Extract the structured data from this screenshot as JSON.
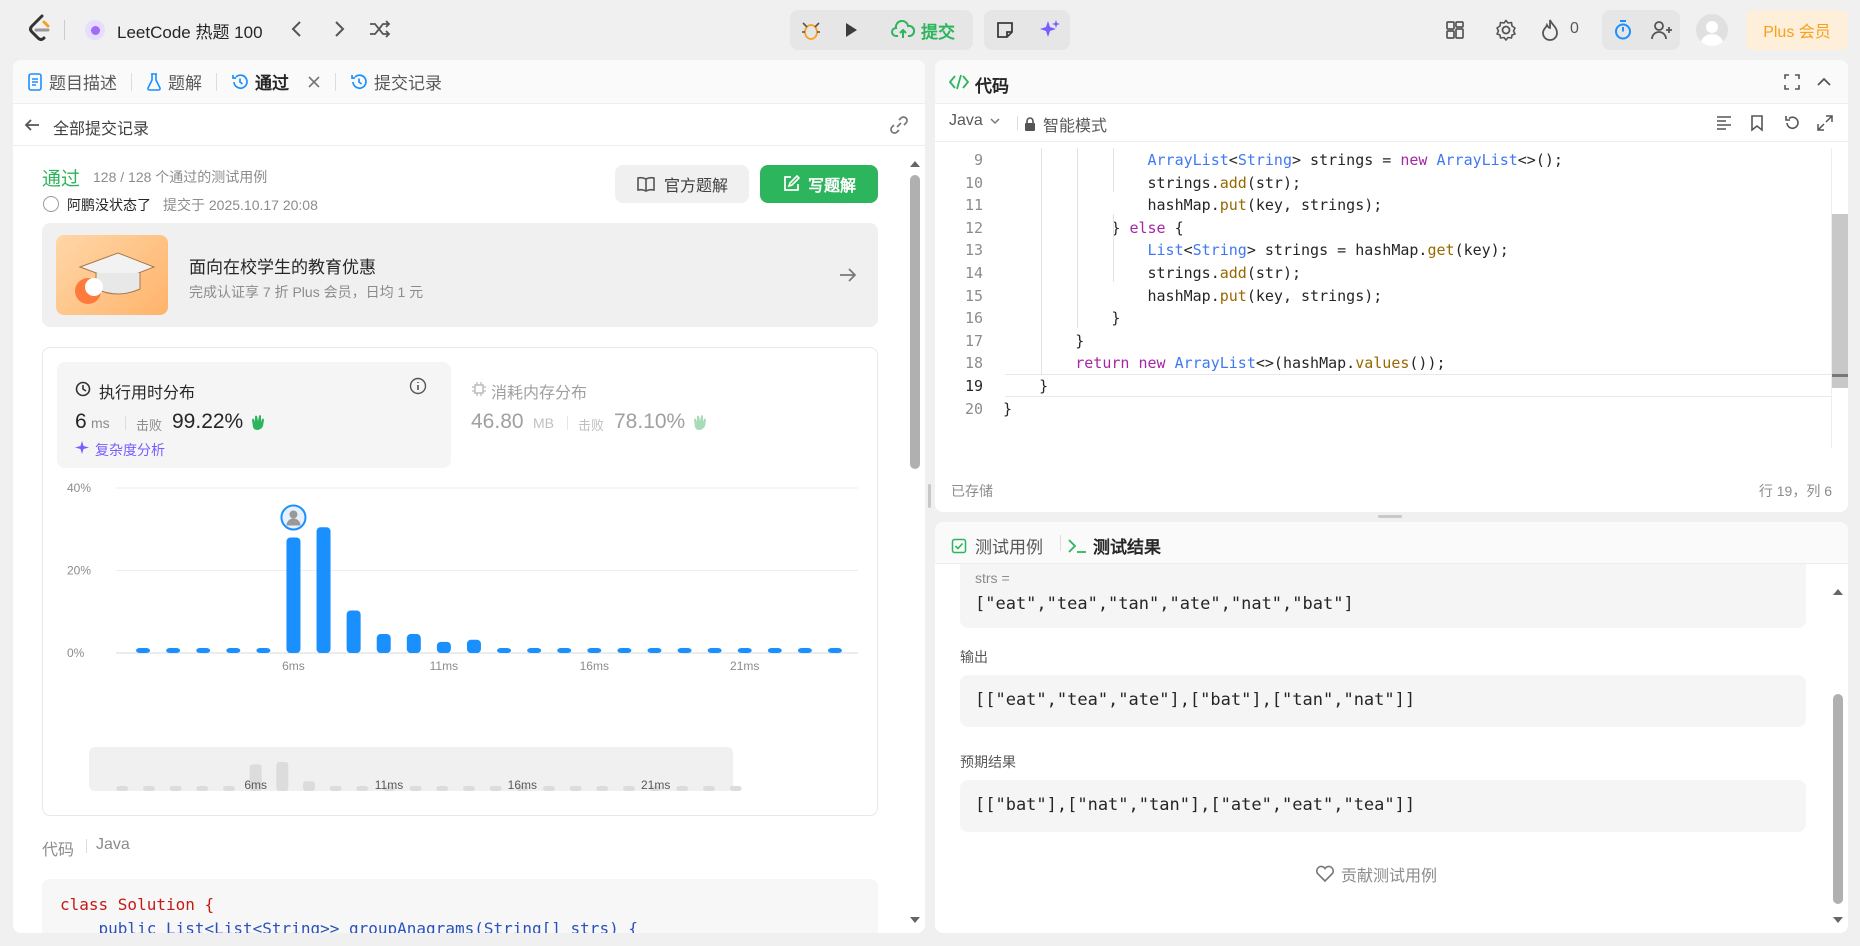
{
  "topbar": {
    "title": "LeetCode 热题 100",
    "submit": "提交",
    "fire_count": "0",
    "plus": "Plus 会员"
  },
  "left": {
    "tabs": [
      {
        "label": "题目描述"
      },
      {
        "label": "题解"
      },
      {
        "label": "通过"
      },
      {
        "label": "提交记录"
      }
    ],
    "back": "全部提交记录",
    "status": "通过",
    "cases": "128 / 128 个通过的测试用例",
    "user": "阿鹏没状态了",
    "submitted": "提交于 2025.10.17 20:08",
    "official": "官方题解",
    "write": "写题解",
    "promo_title": "面向在校学生的教育优惠",
    "promo_sub": "完成认证享 7 折 Plus 会员，日均 1 元",
    "runtime_label": "执行用时分布",
    "runtime_value": "6",
    "runtime_unit": "ms",
    "beat": "击败",
    "runtime_pct": "99.22%",
    "complexity": "复杂度分析",
    "memory_label": "消耗内存分布",
    "memory_value": "46.80",
    "memory_unit": "MB",
    "memory_pct": "78.10%",
    "code_label": "代码",
    "lang": "Java",
    "code1": "class Solution {",
    "code2": "    public List<List<String>> groupAnagrams(String[] strs) {"
  },
  "chart_data": {
    "type": "bar",
    "ylim": [
      0,
      40
    ],
    "yticks": [
      "40%",
      "20%",
      "0%"
    ],
    "xticks": [
      "6ms",
      "11ms",
      "16ms",
      "21ms"
    ],
    "values": [
      1.2,
      1.2,
      1.2,
      1.2,
      1.2,
      28,
      30.5,
      10.3,
      4.6,
      4.6,
      2.7,
      3.2,
      1.2,
      1.2,
      1.2,
      1.2,
      1.2,
      1.2,
      1.2,
      1.2,
      1.2,
      1.2,
      1.2,
      1.2
    ],
    "highlight_index": 5,
    "mini_xticks": [
      "6ms",
      "11ms",
      "16ms",
      "21ms"
    ]
  },
  "right": {
    "code_title": "代码",
    "lang": "Java",
    "mode": "智能模式",
    "lines": [
      {
        "n": "9",
        "t": "                ArrayList<String> strings = new ArrayList<>();"
      },
      {
        "n": "10",
        "t": "                strings.add(str);"
      },
      {
        "n": "11",
        "t": "                hashMap.put(key, strings);"
      },
      {
        "n": "12",
        "t": "            } else {"
      },
      {
        "n": "13",
        "t": "                List<String> strings = hashMap.get(key);"
      },
      {
        "n": "14",
        "t": "                strings.add(str);"
      },
      {
        "n": "15",
        "t": "                hashMap.put(key, strings);"
      },
      {
        "n": "16",
        "t": "            }"
      },
      {
        "n": "17",
        "t": "        }"
      },
      {
        "n": "18",
        "t": "        return new ArrayList<>(hashMap.values());"
      },
      {
        "n": "19",
        "t": "    }"
      },
      {
        "n": "20",
        "t": "}"
      }
    ],
    "saved": "已存储",
    "cursor": "行 19，列 6",
    "test_tab": "测试用例",
    "result_tab": "测试结果",
    "input_name": "strs =",
    "input_value": "[\"eat\",\"tea\",\"tan\",\"ate\",\"nat\",\"bat\"]",
    "output_label": "输出",
    "output_value": "[[\"eat\",\"tea\",\"ate\"],[\"bat\"],[\"tan\",\"nat\"]]",
    "expected_label": "预期结果",
    "expected_value": "[[\"bat\"],[\"nat\",\"tan\"],[\"ate\",\"eat\",\"tea\"]]",
    "contribute": "贡献测试用例"
  }
}
